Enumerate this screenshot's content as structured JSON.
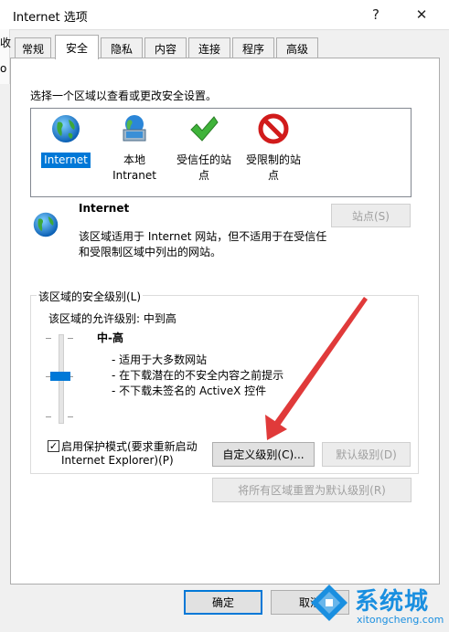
{
  "window": {
    "title": "Internet 选项",
    "help_glyph": "?",
    "close_glyph": "✕"
  },
  "background": {
    "left_fragment": "收",
    "left_fragment2": "o"
  },
  "tabs": [
    {
      "label": "常规"
    },
    {
      "label": "安全",
      "active": true
    },
    {
      "label": "隐私"
    },
    {
      "label": "内容"
    },
    {
      "label": "连接"
    },
    {
      "label": "程序"
    },
    {
      "label": "高级"
    }
  ],
  "security": {
    "instruction": "选择一个区域以查看或更改安全设置。",
    "zones": [
      {
        "label": "Internet",
        "icon": "globe-icon",
        "selected": true
      },
      {
        "label_line1": "本地",
        "label_line2": "Intranet",
        "icon": "intranet-icon"
      },
      {
        "label_line1": "受信任的站",
        "label_line2": "点",
        "icon": "checkmark-icon"
      },
      {
        "label_line1": "受限制的站",
        "label_line2": "点",
        "icon": "restricted-icon"
      }
    ],
    "zone_info": {
      "title": "Internet",
      "desc_line1": "该区域适用于 Internet 网站，但不适用于在受信任",
      "desc_line2": "和受限制区域中列出的网站。"
    },
    "sites_button": "站点(S)",
    "level_group_title": "该区域的安全级别(L)",
    "allowed_levels": "该区域的允许级别: 中到高",
    "current_level": "中-高",
    "bullets": [
      "- 适用于大多数网站",
      "- 在下载潜在的不安全内容之前提示",
      "- 不下载未签名的 ActiveX 控件"
    ],
    "protected_mode": {
      "checked": true,
      "check_glyph": "✓",
      "line1": "启用保护模式(要求重新启动",
      "line2": "Internet Explorer)(P)"
    },
    "custom_level_button": "自定义级别(C)...",
    "default_level_button": "默认级别(D)",
    "reset_all_button": "将所有区域重置为默认级别(R)"
  },
  "footer": {
    "ok_button": "确定",
    "cancel_button": "取消"
  },
  "watermark": {
    "brand": "系统城",
    "url": "xitongcheng.com"
  },
  "colors": {
    "accent": "#0078d7",
    "arrow": "#e03a3a"
  }
}
